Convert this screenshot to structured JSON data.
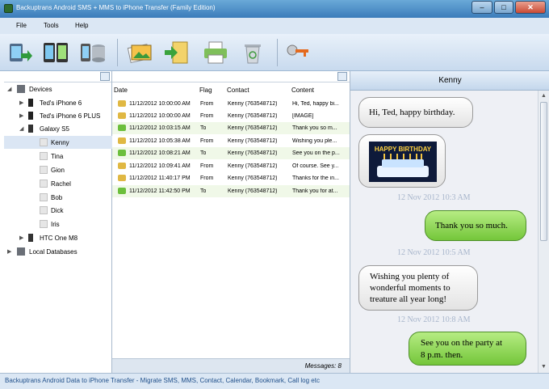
{
  "window": {
    "title": "Backuptrans Android SMS + MMS to iPhone Transfer (Family Edition)",
    "min": "–",
    "max": "□",
    "close": "✕"
  },
  "menu": [
    "File",
    "Tools",
    "Help"
  ],
  "tree": {
    "root": "Devices",
    "devices": [
      {
        "label": "Ted's iPhone 6"
      },
      {
        "label": "Ted's iPhone 6 PLUS"
      },
      {
        "label": "Galaxy S5"
      }
    ],
    "contacts": [
      "Kenny",
      "Tina",
      "Gion",
      "Rachel",
      "Bob",
      "Dick",
      "Iris"
    ],
    "htc": "HTC One M8",
    "localdb": "Local Databases"
  },
  "messages": {
    "columns": {
      "date": "Date",
      "flag": "Flag",
      "contact": "Contact",
      "content": "Content"
    },
    "rows": [
      {
        "date": "11/12/2012 10:00:00 AM",
        "flag": "From",
        "contact": "Kenny (763548712)",
        "content": "Hi, Ted, happy bi..."
      },
      {
        "date": "11/12/2012 10:00:00 AM",
        "flag": "From",
        "contact": "Kenny (763548712)",
        "content": "[IMAGE]"
      },
      {
        "date": "11/12/2012 10:03:15 AM",
        "flag": "To",
        "contact": "Kenny (763548712)",
        "content": "Thank you so m..."
      },
      {
        "date": "11/12/2012 10:05:38 AM",
        "flag": "From",
        "contact": "Kenny (763548712)",
        "content": "Wishing you ple..."
      },
      {
        "date": "11/12/2012 10:08:21 AM",
        "flag": "To",
        "contact": "Kenny (763548712)",
        "content": "See you on the p..."
      },
      {
        "date": "11/12/2012 10:09:41 AM",
        "flag": "From",
        "contact": "Kenny (763548712)",
        "content": "Of course. See y..."
      },
      {
        "date": "11/12/2012 11:40:17 PM",
        "flag": "From",
        "contact": "Kenny (763548712)",
        "content": "Thanks for the in..."
      },
      {
        "date": "11/12/2012 11:42:50 PM",
        "flag": "To",
        "contact": "Kenny (763548712)",
        "content": "Thank you for at..."
      }
    ],
    "count": "Messages: 8"
  },
  "chat": {
    "contact": "Kenny",
    "b1": "Hi, Ted, happy birthday.",
    "image_text": "HAPPY BIRTHDAY",
    "ts1": "12 Nov 2012 10:3 AM",
    "b3": "Thank you so much.",
    "ts2": "12 Nov 2012 10:5 AM",
    "b4": [
      "Wishing you plenty of",
      "wonderful moments to",
      "treature all year long!"
    ],
    "ts3": "12 Nov 2012 10:8 AM",
    "b5": [
      "See you on the party at",
      "8 p.m. then."
    ]
  },
  "status": "Backuptrans Android Data to iPhone Transfer - Migrate SMS, MMS, Contact, Calendar, Bookmark, Call log etc",
  "colors": {
    "accent": "#3b7cba",
    "outgoing": "#74c63a",
    "incoming": "#e3e3e3",
    "selected_row": "#dbe6f4"
  }
}
